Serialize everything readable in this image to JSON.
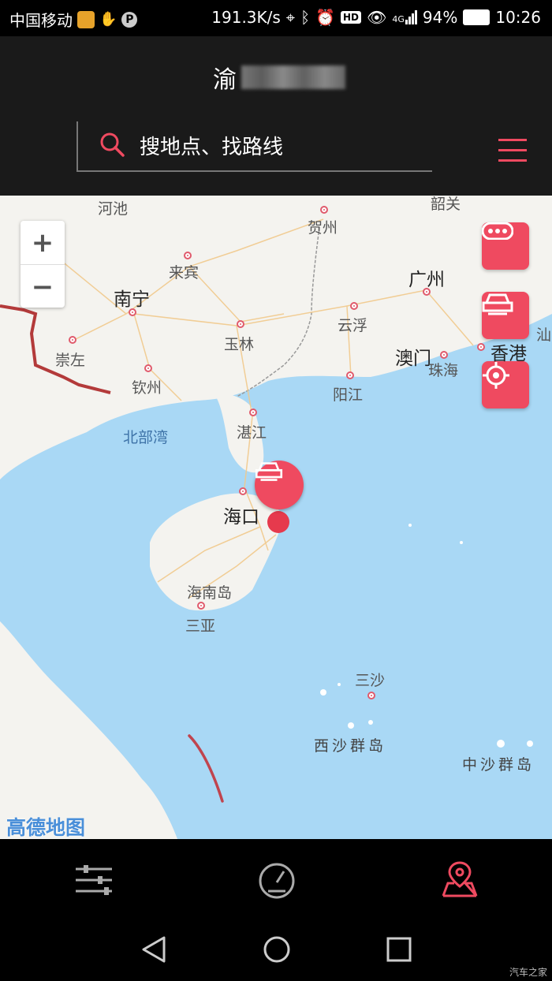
{
  "status_bar": {
    "carrier": "中国移动",
    "speed": "191.3K/s",
    "network": "4G",
    "battery": "94%",
    "time": "10:26",
    "icons": [
      "weibo-icon",
      "hand-icon",
      "parking-icon",
      "location-icon",
      "bluetooth-icon",
      "alarm-icon",
      "hd-icon",
      "eye-icon",
      "signal-icon",
      "battery-icon"
    ]
  },
  "header": {
    "plate_prefix": "渝",
    "search_placeholder": "搜地点、找路线",
    "menu_icon": "menu-icon"
  },
  "map": {
    "provider_logo": "高德地图",
    "zoom_in": "+",
    "zoom_out": "−",
    "labels": {
      "hechi": "河池",
      "hezhou": "贺州",
      "shaoguan": "韶关",
      "laibin": "来宾",
      "nanning": "南宁",
      "guangzhou": "广州",
      "yulin": "玉林",
      "yunfu": "云浮",
      "chongzuo": "崇左",
      "qinzhou": "钦州",
      "macau": "澳门",
      "zhuhai": "珠海",
      "hongkong": "香港",
      "shantou": "汕",
      "yangjiang": "阳江",
      "beibu": "北部湾",
      "zhanjiang": "湛江",
      "haikou": "海口",
      "hainan": "海南岛",
      "sanya": "三亚",
      "sansha": "三沙",
      "xisha": "西沙群岛",
      "zhongsha": "中沙群岛"
    },
    "colors": {
      "water": "#a9d8f5",
      "land": "#f4f3ef",
      "accent": "#ef4a60",
      "border": "#b33a3a"
    }
  },
  "bottom_nav": {
    "icons": [
      "settings-sliders-icon",
      "speedometer-icon",
      "map-location-icon"
    ],
    "active": "map-location-icon"
  },
  "watermark": "汽车之家"
}
